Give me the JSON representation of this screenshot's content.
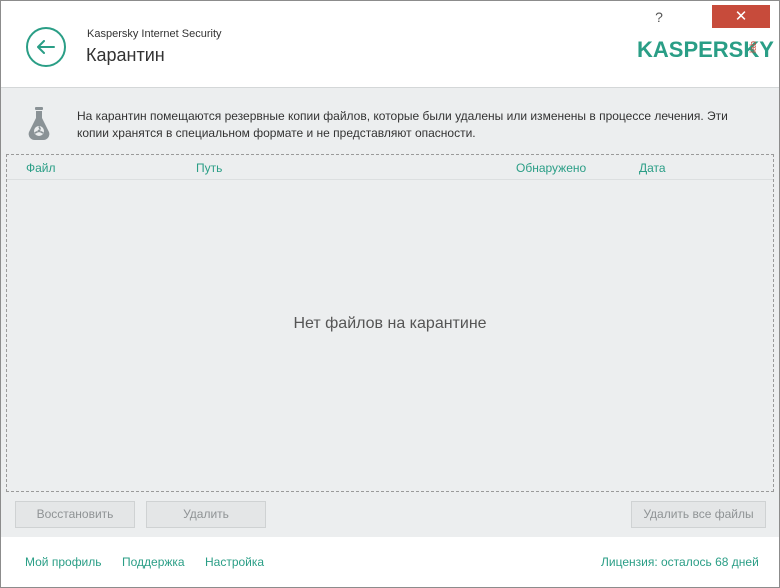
{
  "header": {
    "app_name": "Kaspersky Internet Security",
    "title": "Карантин",
    "help_label": "?",
    "close_label": "✕",
    "logo_text": "KASPERSKY",
    "logo_sub": "lab"
  },
  "info": {
    "text": "На карантин помещаются резервные копии файлов, которые были удалены или изменены в процессе лечения. Эти копии хранятся в специальном формате и не представляют опасности."
  },
  "table": {
    "columns": [
      "Файл",
      "Путь",
      "Обнаружено",
      "Дата"
    ],
    "empty_message": "Нет файлов на карантине"
  },
  "actions": {
    "restore": "Восстановить",
    "delete": "Удалить",
    "delete_all": "Удалить все файлы"
  },
  "footer": {
    "profile": "Мой профиль",
    "support": "Поддержка",
    "settings": "Настройка",
    "license": "Лицензия: осталось 68 дней"
  },
  "colors": {
    "accent": "#2a9e86",
    "close": "#c74b3b",
    "panel_bg": "#eceeef"
  }
}
